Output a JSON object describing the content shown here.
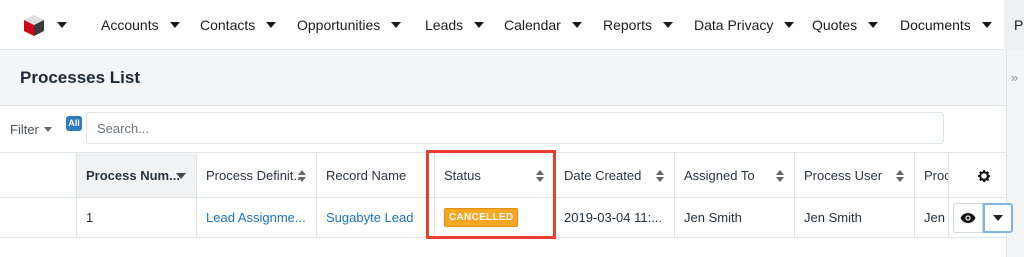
{
  "nav": {
    "items": [
      {
        "label": "Accounts"
      },
      {
        "label": "Contacts"
      },
      {
        "label": "Opportunities"
      },
      {
        "label": "Leads"
      },
      {
        "label": "Calendar"
      },
      {
        "label": "Reports"
      },
      {
        "label": "Data Privacy"
      },
      {
        "label": "Quotes"
      },
      {
        "label": "Documents"
      }
    ],
    "overflow_label": "Pr"
  },
  "header": {
    "title": "Processes List"
  },
  "sidebar_toggle": "»",
  "filter": {
    "label": "Filter",
    "badge": "All",
    "search_placeholder": "Search..."
  },
  "table": {
    "columns": [
      {
        "label": "Process Num..."
      },
      {
        "label": "Process Definit..."
      },
      {
        "label": "Record Name"
      },
      {
        "label": "Status"
      },
      {
        "label": "Date Created"
      },
      {
        "label": "Assigned To"
      },
      {
        "label": "Process User"
      },
      {
        "label": "Proc"
      }
    ],
    "rows": [
      {
        "process_number": "1",
        "process_definition": "Lead Assignme...",
        "record_name": "Sugabyte Lead",
        "status": "CANCELLED",
        "date_created": "2019-03-04 11:...",
        "assigned_to": "Jen Smith",
        "process_user": "Jen Smith",
        "proc": "Jen S"
      }
    ]
  },
  "colors": {
    "accent": "#1a73c8",
    "status_cancelled": "#f5a623",
    "highlight": "#e8402d",
    "logo_red": "#d0021b"
  }
}
